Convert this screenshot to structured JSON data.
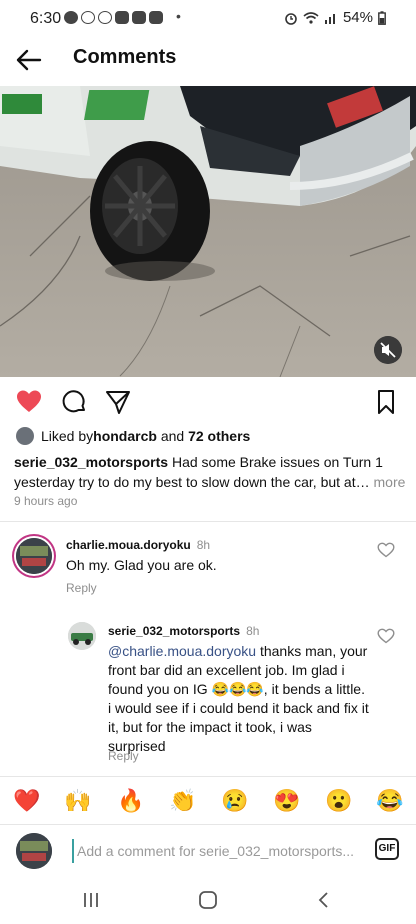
{
  "status_bar": {
    "time": "6:30",
    "battery": "54%"
  },
  "header": {
    "title": "Comments"
  },
  "post": {
    "liked_by_prefix": "Liked by ",
    "liked_by_user": "hondarcb",
    "liked_by_and": " and ",
    "liked_by_others": "72 others",
    "author": "serie_032_motorsports",
    "caption": " Had some Brake issues on Turn 1 yesterday try to do my best to slow down the car, but at…",
    "more": " more",
    "time": "9 hours ago"
  },
  "comments": [
    {
      "username": "charlie.moua.doryoku",
      "time": "8h",
      "text": "Oh my. Glad you are ok.",
      "reply_label": "Reply"
    },
    {
      "username": "serie_032_motorsports",
      "time": "8h",
      "mention": "@charlie.moua.doryoku",
      "text": " thanks man, your front bar did an excellent job. Im glad i found you on IG 😂😂😂, it bends a little. i would see if i could bend it back and fix it it, but for the impact it took, i was surprised",
      "reply_label": "Reply"
    }
  ],
  "quick_reactions": [
    "❤️",
    "🙌",
    "🔥",
    "👏",
    "😢",
    "😍",
    "😮",
    "😂"
  ],
  "composer": {
    "placeholder": "Add a comment for serie_032_motorsports...",
    "gif_label": "GIF"
  },
  "colors": {
    "like_red": "#ed4956",
    "mention_blue": "#385185",
    "story_ring": "#c13584"
  }
}
